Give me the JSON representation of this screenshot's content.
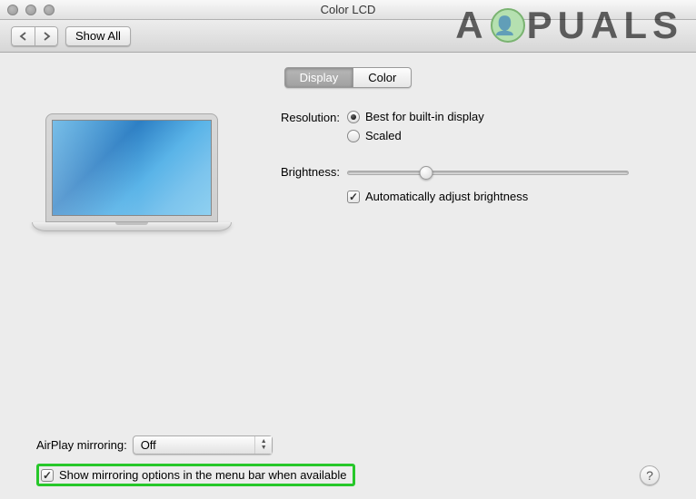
{
  "window": {
    "title": "Color LCD"
  },
  "toolbar": {
    "show_all": "Show All"
  },
  "tabs": {
    "display": "Display",
    "color": "Color"
  },
  "settings": {
    "resolution": {
      "label": "Resolution:",
      "best": "Best for built-in display",
      "scaled": "Scaled"
    },
    "brightness": {
      "label": "Brightness:",
      "auto": "Automatically adjust brightness"
    }
  },
  "bottom": {
    "airplay_label": "AirPlay mirroring:",
    "airplay_value": "Off",
    "show_mirroring": "Show mirroring options in the menu bar when available"
  },
  "help": "?",
  "watermark": {
    "left": "A",
    "right": "PUALS"
  }
}
